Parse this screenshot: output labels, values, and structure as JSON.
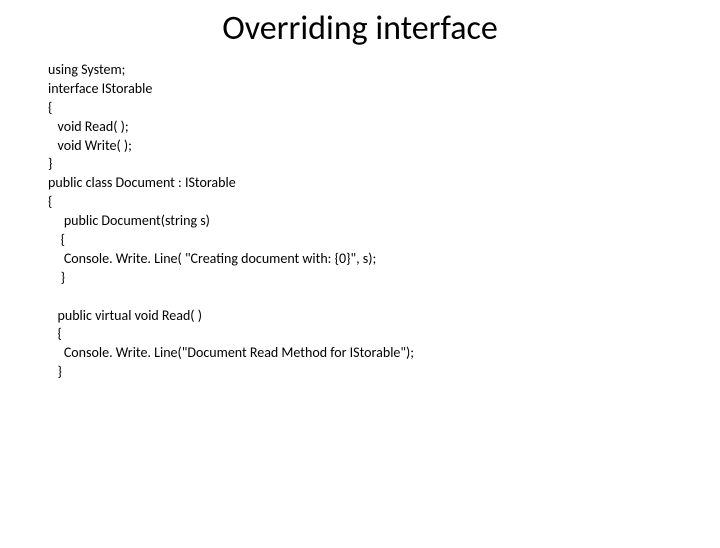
{
  "title": "Overriding interface",
  "code_lines": [
    "using System;",
    "interface IStorable",
    "{",
    "   void Read( );",
    "   void Write( );",
    "}",
    "public class Document : IStorable",
    "{",
    "     public Document(string s)",
    "    {",
    "     Console. Write. Line( \"Creating document with: {0}\", s);",
    "    }",
    "",
    "   public virtual void Read( )",
    "   {",
    "     Console. Write. Line(\"Document Read Method for IStorable\");",
    "   }"
  ]
}
